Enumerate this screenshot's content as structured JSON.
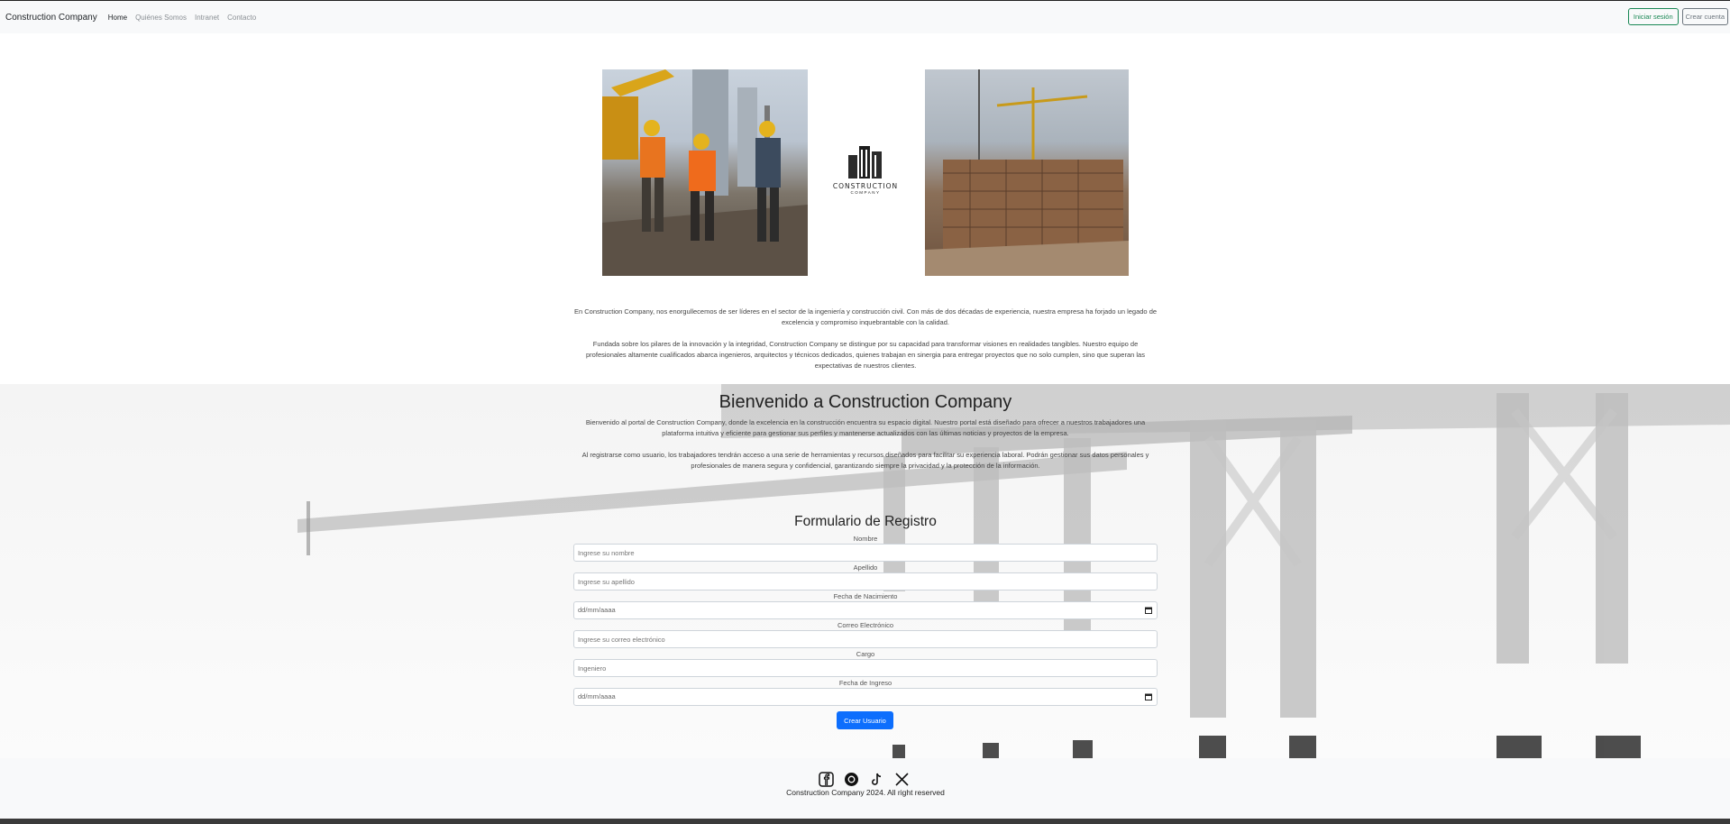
{
  "nav": {
    "brand": "Construction Company",
    "links": [
      "Home",
      "Quiénes Somos",
      "Intranet",
      "Contacto"
    ],
    "login_label": "Iniciar sesión",
    "signup_label": "Crear cuenta"
  },
  "hero": {
    "logo_line1": "CONSTRUCTION",
    "logo_line2": "COMPANY"
  },
  "intro": {
    "p1": "En Construction Company, nos enorgullecemos de ser líderes en el sector de la ingeniería y construcción civil. Con más de dos décadas de experiencia, nuestra empresa ha forjado un legado de excelencia y compromiso inquebrantable con la calidad.",
    "p2": "Fundada sobre los pilares de la innovación y la integridad, Construction Company se distingue por su capacidad para transformar visiones en realidades tangibles. Nuestro equipo de profesionales altamente cualificados abarca ingenieros, arquitectos y técnicos dedicados, quienes trabajan en sinergia para entregar proyectos que no solo cumplen, sino que superan las expectativas de nuestros clientes."
  },
  "welcome": {
    "title": "Bienvenido a Construction Company",
    "p1": "Bienvenido al portal de Construction Company, donde la excelencia en la construcción encuentra su espacio digital. Nuestro portal está diseñado para ofrecer a nuestros trabajadores una plataforma intuitiva y eficiente para gestionar sus perfiles y mantenerse actualizados con las últimas noticias y proyectos de la empresa.",
    "p2": "Al registrarse como usuario, los trabajadores tendrán acceso a una serie de herramientas y recursos diseñados para facilitar su experiencia laboral. Podrán gestionar sus datos personales y profesionales de manera segura y confidencial, garantizando siempre la privacidad y la protección de la información."
  },
  "form": {
    "title": "Formulario de Registro",
    "fields": [
      {
        "label": "Nombre",
        "placeholder": "Ingrese su nombre"
      },
      {
        "label": "Apellido",
        "placeholder": "Ingrese su apellido"
      },
      {
        "label": "Fecha de Nacimiento",
        "placeholder": "dd/mm/aaaa"
      },
      {
        "label": "Correo Electrónico",
        "placeholder": "Ingrese su correo electrónico"
      },
      {
        "label": "Cargo",
        "placeholder": "Ingeniero"
      },
      {
        "label": "Fecha de Ingreso",
        "placeholder": "dd/mm/aaaa"
      }
    ],
    "submit_label": "Crear Usuario"
  },
  "footer": {
    "icons": [
      "facebook-icon",
      "threads-icon",
      "tiktok-icon",
      "x-icon"
    ],
    "copyright": "Construction Company 2024. All right reserved"
  }
}
